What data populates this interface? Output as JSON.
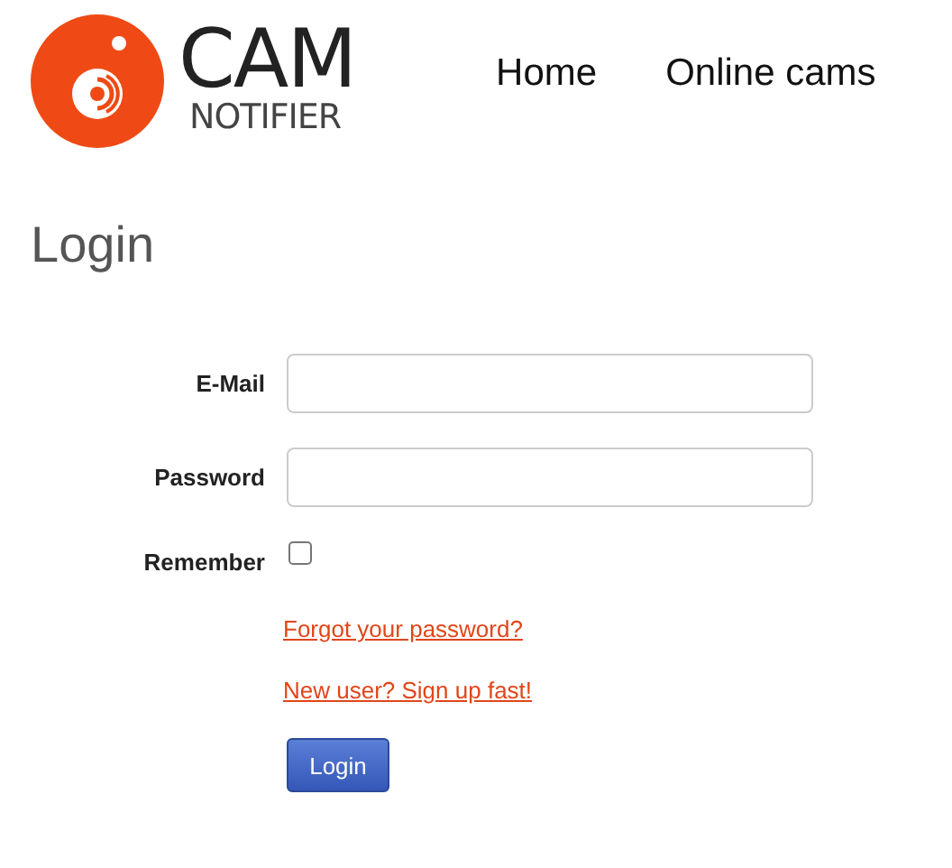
{
  "logo": {
    "title": "CAM",
    "subtitle": "NOTIFIER"
  },
  "nav": [
    {
      "label": "Home"
    },
    {
      "label": "Online cams"
    }
  ],
  "heading": "Login",
  "fields": [
    {
      "label": "E-Mail"
    },
    {
      "label": "Password"
    }
  ],
  "remember": {
    "label": "Remember",
    "checked": false
  },
  "links": [
    "Forgot your password?",
    "New user? Sign up fast!"
  ],
  "button": "Login"
}
